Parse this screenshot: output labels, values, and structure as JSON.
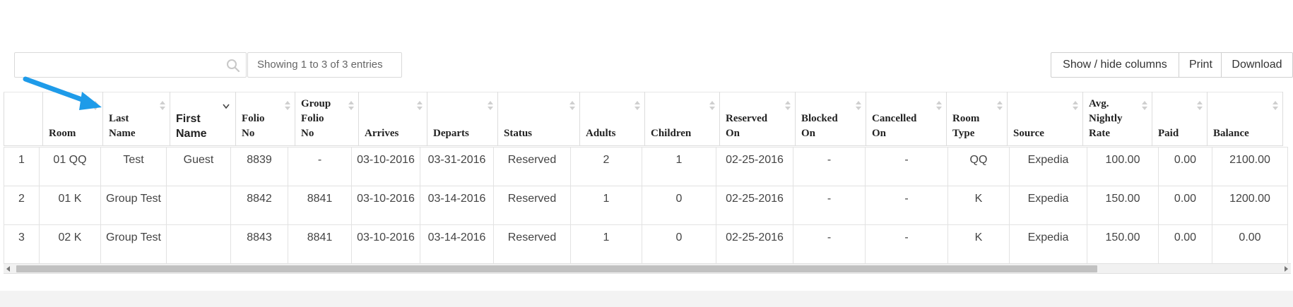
{
  "search": {
    "value": "",
    "placeholder": ""
  },
  "table_info": "Showing 1 to 3 of 3 entries",
  "toolbar": {
    "show_hide": "Show / hide columns",
    "print": "Print",
    "download": "Download"
  },
  "headers": [
    "",
    "Room",
    "Last Name",
    "First Name",
    "Folio No",
    "Group Folio No",
    "Arrives",
    "Departs",
    "Status",
    "Adults",
    "Children",
    "Reserved On",
    "Blocked On",
    "Cancelled On",
    "Room Type",
    "Source",
    "Avg. Nightly Rate",
    "Paid",
    "Balance"
  ],
  "header_html": [
    "",
    "Room",
    "Last<br>Name",
    "First<br>Name",
    "Folio<br>No",
    "Group<br>Folio<br>No",
    "Arrives",
    "Departs",
    "Status",
    "Adults",
    "Children",
    "Reserved<br>On",
    "Blocked<br>On",
    "Cancelled<br>On",
    "Room<br>Type",
    "Source",
    "Avg.<br>Nightly<br>Rate",
    "Paid",
    "Balance"
  ],
  "rows": [
    {
      "num": "1",
      "room": "01 QQ",
      "last_name": "Test",
      "first_name": "Guest",
      "folio": "8839",
      "group_folio": "-",
      "arrives": "03-10-2016",
      "departs": "03-31-2016",
      "status": "Reserved",
      "adults": "2",
      "children": "1",
      "reserved_on": "02-25-2016",
      "blocked_on": "-",
      "cancelled_on": "-",
      "room_type": "QQ",
      "source": "Expedia",
      "rate": "100.00",
      "paid": "0.00",
      "balance": "2100.00"
    },
    {
      "num": "2",
      "room": "01 K",
      "last_name": "Group Test",
      "first_name": "",
      "folio": "8842",
      "group_folio": "8841",
      "arrives": "03-10-2016",
      "departs": "03-14-2016",
      "status": "Reserved",
      "adults": "1",
      "children": "0",
      "reserved_on": "02-25-2016",
      "blocked_on": "-",
      "cancelled_on": "-",
      "room_type": "K",
      "source": "Expedia",
      "rate": "150.00",
      "paid": "0.00",
      "balance": "1200.00"
    },
    {
      "num": "3",
      "room": "02 K",
      "last_name": "Group Test",
      "first_name": "",
      "folio": "8843",
      "group_folio": "8841",
      "arrives": "03-10-2016",
      "departs": "03-14-2016",
      "status": "Reserved",
      "adults": "1",
      "children": "0",
      "reserved_on": "02-25-2016",
      "blocked_on": "-",
      "cancelled_on": "-",
      "room_type": "K",
      "source": "Expedia",
      "rate": "150.00",
      "paid": "0.00",
      "balance": "0.00"
    }
  ],
  "colors": {
    "link": "#2a9fd0",
    "annotation_arrow": "#1e9be9",
    "scroll_thumb": "#c1c1c1"
  },
  "icons": {
    "search": "search-icon",
    "sort": "sort-icon",
    "annotation": "annotation-arrow-icon"
  }
}
